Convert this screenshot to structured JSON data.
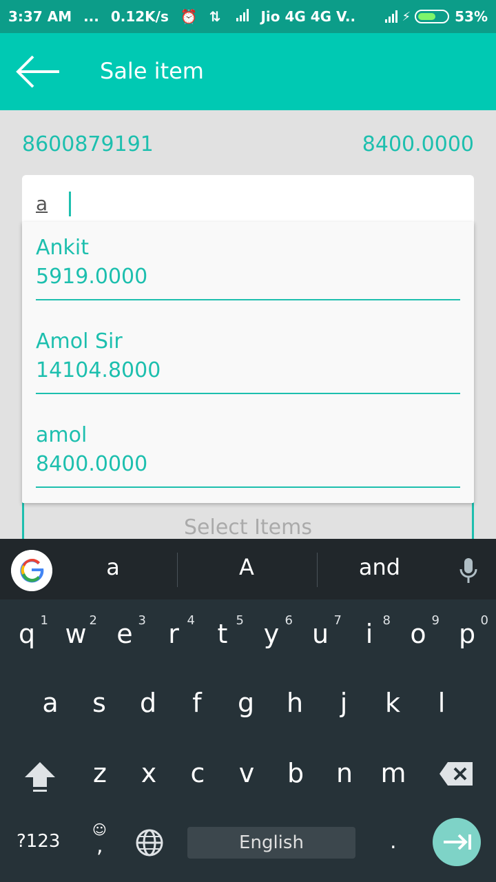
{
  "status_bar": {
    "time": "3:37 AM",
    "dots": "...",
    "speed": "0.12K/s",
    "carrier": "Jio 4G 4G V..",
    "battery": "53%"
  },
  "app_bar": {
    "title": "Sale item"
  },
  "info": {
    "phone": "8600879191",
    "amount": "8400.0000"
  },
  "search": {
    "value": "a"
  },
  "dropdown": {
    "items": [
      {
        "name": "Ankit",
        "amount": "5919.0000"
      },
      {
        "name": "Amol Sir",
        "amount": "14104.8000"
      },
      {
        "name": "amol",
        "amount": "8400.0000"
      }
    ]
  },
  "select_items": {
    "label": "Select Items"
  },
  "keyboard": {
    "suggestions": [
      "a",
      "A",
      "and"
    ],
    "row1": [
      "q",
      "w",
      "e",
      "r",
      "t",
      "y",
      "u",
      "i",
      "o",
      "p"
    ],
    "row1_hints": [
      "1",
      "2",
      "3",
      "4",
      "5",
      "6",
      "7",
      "8",
      "9",
      "0"
    ],
    "row2": [
      "a",
      "s",
      "d",
      "f",
      "g",
      "h",
      "j",
      "k",
      "l"
    ],
    "row3": [
      "z",
      "x",
      "c",
      "v",
      "b",
      "n",
      "m"
    ],
    "symbols_label": "?123",
    "comma": ",",
    "period": ".",
    "space_label": "English"
  },
  "colors": {
    "accent": "#00c9b3",
    "status_bar": "#0c9d89",
    "text_teal": "#1dbfae",
    "keyboard_bg": "#263238"
  }
}
